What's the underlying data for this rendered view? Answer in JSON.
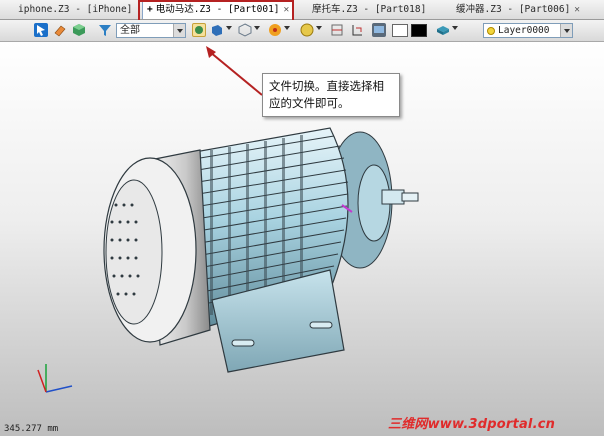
{
  "tabs": [
    {
      "label": "iphone.Z3 - [iPhone]",
      "closable": false,
      "active": false
    },
    {
      "label": "电动马达.Z3 - [Part001]",
      "closable": true,
      "active": true
    },
    {
      "label": "摩托车.Z3 - [Part018]",
      "closable": false,
      "active": false
    },
    {
      "label": "缓冲器.Z3 - [Part006]",
      "closable": true,
      "active": false
    }
  ],
  "toolbar": {
    "filter_value": "全部",
    "layer_value": "Layer0000",
    "icons": [
      "pick-icon",
      "eraser-icon",
      "cube-icon",
      "filter-icon",
      "view-cube-icon",
      "shade-icon",
      "rotate-icon",
      "color-icon",
      "render-icon",
      "section-icon",
      "bounds-icon",
      "monitor-icon",
      "white-color",
      "black-color",
      "material-icon",
      "layer-bulb-icon"
    ]
  },
  "callout": {
    "text": "文件切换。直接选择相应的文件即可。"
  },
  "status": {
    "coordinate": "345.277 mm"
  },
  "watermark": "三维网www.3dportal.cn",
  "colors": {
    "highlight_border": "#b52222",
    "arrow": "#b52222",
    "model_body": "#a9d3e1",
    "model_dark": "#2f3a40"
  }
}
